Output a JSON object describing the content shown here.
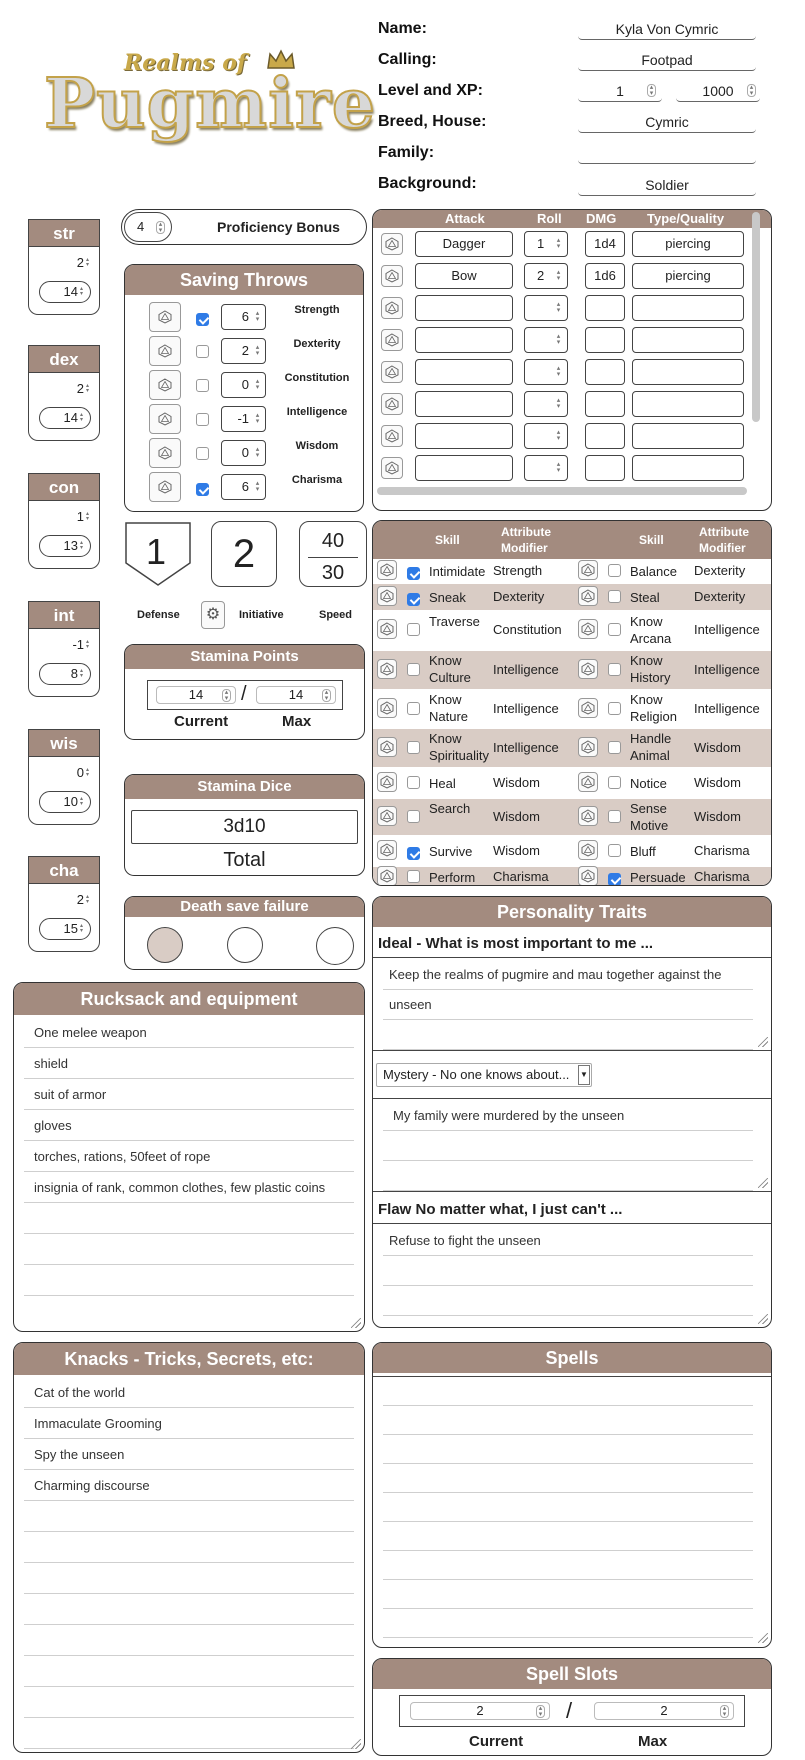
{
  "logo": {
    "top": "Realms of",
    "main": "Pugmire"
  },
  "header": {
    "name_label": "Name:",
    "name": "Kyla Von Cymric",
    "calling_label": "Calling:",
    "calling": "Footpad",
    "level_label": "Level and XP:",
    "level": "1",
    "xp": "1000",
    "breed_label": "Breed, House:",
    "breed": "Cymric",
    "family_label": "Family:",
    "family": "",
    "background_label": "Background:",
    "background": "Soldier"
  },
  "attributes": [
    {
      "name": "str",
      "mod": "2",
      "score": "14"
    },
    {
      "name": "dex",
      "mod": "2",
      "score": "14"
    },
    {
      "name": "con",
      "mod": "1",
      "score": "13"
    },
    {
      "name": "int",
      "mod": "-1",
      "score": "8"
    },
    {
      "name": "wis",
      "mod": "0",
      "score": "10"
    },
    {
      "name": "cha",
      "mod": "2",
      "score": "15"
    }
  ],
  "proficiency": {
    "value": "4",
    "label": "Proficiency Bonus"
  },
  "saving_throws": {
    "title": "Saving Throws",
    "rows": [
      {
        "label": "Strength",
        "value": "6",
        "checked": true
      },
      {
        "label": "Dexterity",
        "value": "2",
        "checked": false
      },
      {
        "label": "Constitution",
        "value": "0",
        "checked": false
      },
      {
        "label": "Intelligence",
        "value": "-1",
        "checked": false
      },
      {
        "label": "Wisdom",
        "value": "0",
        "checked": false
      },
      {
        "label": "Charisma",
        "value": "6",
        "checked": true
      }
    ]
  },
  "combat": {
    "defense": "1",
    "initiative": "2",
    "speed_top": "40",
    "speed_bottom": "30",
    "defense_label": "Defense",
    "initiative_label": "Initiative",
    "speed_label": "Speed"
  },
  "stamina_points": {
    "title": "Stamina Points",
    "current": "14",
    "max": "14",
    "current_label": "Current",
    "max_label": "Max",
    "sep": "/"
  },
  "stamina_dice": {
    "title": "Stamina Dice",
    "value": "3d10",
    "total_label": "Total"
  },
  "death_save": {
    "title": "Death save failure",
    "filled": 1
  },
  "attacks": {
    "headers": [
      "Attack",
      "Roll",
      "DMG",
      "Type/Quality"
    ],
    "rows": [
      {
        "attack": "Dagger",
        "roll": "1",
        "dmg": "1d4",
        "type": "piercing"
      },
      {
        "attack": "Bow",
        "roll": "2",
        "dmg": "1d6",
        "type": "piercing"
      },
      {
        "attack": "",
        "roll": "",
        "dmg": "",
        "type": ""
      },
      {
        "attack": "",
        "roll": "",
        "dmg": "",
        "type": ""
      },
      {
        "attack": "",
        "roll": "",
        "dmg": "",
        "type": ""
      },
      {
        "attack": "",
        "roll": "",
        "dmg": "",
        "type": ""
      },
      {
        "attack": "",
        "roll": "",
        "dmg": "",
        "type": ""
      },
      {
        "attack": "",
        "roll": "",
        "dmg": "",
        "type": ""
      }
    ]
  },
  "skills": {
    "headers": [
      "Skill",
      "Attribute Modifier",
      "Skill",
      "Attribute Modifier"
    ],
    "rows": [
      {
        "l_skill": "Intimidate",
        "l_attr": "Strength",
        "l_on": true,
        "r_skill": "Balance",
        "r_attr": "Dexterity",
        "r_on": false
      },
      {
        "l_skill": "Sneak",
        "l_attr": "Dexterity",
        "l_on": true,
        "r_skill": "Steal",
        "r_attr": "Dexterity",
        "r_on": false
      },
      {
        "l_skill": "Traverse",
        "l_attr": "Constitution",
        "l_on": false,
        "r_skill": "Know Arcana",
        "r_attr": "Intelligence",
        "r_on": false
      },
      {
        "l_skill": "Know Culture",
        "l_attr": "Intelligence",
        "l_on": false,
        "r_skill": "Know History",
        "r_attr": "Intelligence",
        "r_on": false
      },
      {
        "l_skill": "Know Nature",
        "l_attr": "Intelligence",
        "l_on": false,
        "r_skill": "Know Religion",
        "r_attr": "Intelligence",
        "r_on": false
      },
      {
        "l_skill": "Know Spirituality",
        "l_attr": "Intelligence",
        "l_on": false,
        "r_skill": "Handle Animal",
        "r_attr": "Wisdom",
        "r_on": false
      },
      {
        "l_skill": "Heal",
        "l_attr": "Wisdom",
        "l_on": false,
        "r_skill": "Notice",
        "r_attr": "Wisdom",
        "r_on": false
      },
      {
        "l_skill": "Search",
        "l_attr": "Wisdom",
        "l_on": false,
        "r_skill": "Sense Motive",
        "r_attr": "Wisdom",
        "r_on": false
      },
      {
        "l_skill": "Survive",
        "l_attr": "Wisdom",
        "l_on": true,
        "r_skill": "Bluff",
        "r_attr": "Charisma",
        "r_on": false
      },
      {
        "l_skill": "Perform",
        "l_attr": "Charisma",
        "l_on": false,
        "r_skill": "Persuade",
        "r_attr": "Charisma",
        "r_on": true
      }
    ]
  },
  "personality": {
    "title": "Personality Traits",
    "ideal_label": "Ideal - What is most important to me ...",
    "ideal_lines": [
      "Keep the realms of pugmire and mau together against the",
      "unseen",
      ""
    ],
    "mystery_select": "Mystery - No one knows about...",
    "mystery_lines": [
      "My family were murdered by the unseen",
      "",
      ""
    ],
    "flaw_label": "Flaw No matter what, I just can't ...",
    "flaw_lines": [
      "Refuse to fight the unseen",
      "",
      ""
    ]
  },
  "rucksack": {
    "title": "Rucksack and equipment",
    "lines": [
      "One melee weapon",
      "shield",
      "suit of armor",
      "gloves",
      "torches, rations, 50feet of rope",
      "insignia of rank, common clothes, few plastic coins",
      "",
      "",
      ""
    ]
  },
  "knacks": {
    "title": "Knacks - Tricks, Secrets, etc:",
    "lines": [
      "Cat of the world",
      "Immaculate Grooming",
      "Spy the unseen",
      "Charming discourse",
      "",
      "",
      "",
      "",
      "",
      "",
      "",
      ""
    ]
  },
  "spells": {
    "title": "Spells"
  },
  "spell_slots": {
    "title": "Spell Slots",
    "current": "2",
    "max": "2",
    "current_label": "Current",
    "max_label": "Max",
    "sep": "/"
  },
  "colors": {
    "accent": "#a38b7f",
    "shade": "#d9ccc5",
    "check": "#2f7be6"
  },
  "icons": {
    "die": "d20-die-icon"
  }
}
